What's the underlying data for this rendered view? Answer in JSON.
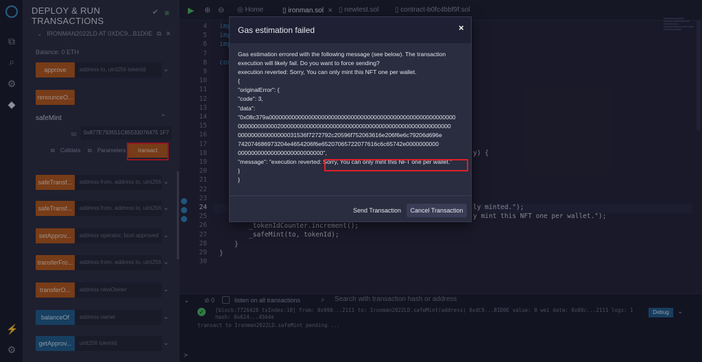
{
  "side_panel": {
    "title": "DEPLOY & RUN TRANSACTIONS",
    "contract_name": "IRONMAN2022LD AT 0XDC9...B1D0E",
    "balance": "Balance: 0 ETH",
    "functions": [
      {
        "label": "approve",
        "placeholder": "address to, uint256 tokenId",
        "color": "orange"
      },
      {
        "label": "renounceO...",
        "placeholder": "",
        "color": "orange"
      }
    ],
    "safemint": {
      "label": "safeMint",
      "to_label": "to:",
      "to_value": "0x877E793551C85533076475 1F7",
      "calldata_label": "Calldata",
      "parameters_label": "Parameters",
      "transact_label": "transact"
    },
    "more_functions": [
      {
        "label": "safeTransf...",
        "placeholder": "address from, address to, uint256",
        "color": "orange"
      },
      {
        "label": "safeTransf...",
        "placeholder": "address from, address to, uint256",
        "color": "orange"
      },
      {
        "label": "setApprov...",
        "placeholder": "address operator, bool approved",
        "color": "orange"
      },
      {
        "label": "transferFro...",
        "placeholder": "address from, address to, uint256",
        "color": "orange"
      },
      {
        "label": "transferO...",
        "placeholder": "address newOwner",
        "color": "orange"
      },
      {
        "label": "balanceOf",
        "placeholder": "address owner",
        "color": "blue"
      },
      {
        "label": "getApprov...",
        "placeholder": "uint256 tokenId",
        "color": "blue"
      }
    ]
  },
  "editor": {
    "tabs": [
      {
        "label": "Home"
      },
      {
        "label": "ironman.sol"
      },
      {
        "label": "newtest.sol"
      },
      {
        "label": "contract-b0fc4bbf9f.sol"
      }
    ],
    "line_numbers": [
      "4",
      "5",
      "6",
      "7",
      "8",
      "9",
      "10",
      "11",
      "12",
      "13",
      "14",
      "15",
      "16",
      "17",
      "18",
      "19",
      "20",
      "21",
      "22",
      "23",
      "24",
      "25",
      "26",
      "27",
      "28",
      "29",
      "30"
    ],
    "code_visible": [
      {
        "line": "4",
        "text": "imp"
      },
      {
        "line": "5",
        "text": "imp"
      },
      {
        "line": "6",
        "text": "imp"
      },
      {
        "line": "8",
        "text": "con"
      },
      {
        "line": "18",
        "text": "y) {"
      },
      {
        "line": "24",
        "text": "ly minted.\");"
      },
      {
        "line": "25",
        "text": "y mint this NFT one per wallet.\");"
      },
      {
        "line": "26",
        "text": "_tokenIdCounter.increment();"
      },
      {
        "line": "27",
        "text": "_safeMint(to, tokenId);"
      },
      {
        "line": "28",
        "text": "}"
      },
      {
        "line": "29",
        "text": "}"
      }
    ]
  },
  "terminal": {
    "count": "0",
    "listen_label": "listen on all transactions",
    "search_placeholder": "Search with transaction hash or address",
    "log_line1": "[block:7726428 txIndex:18]  from: 0x990...2111  to: Ironman2022LD.safeMint(address) 0xdC9...B1D0E  value: 0 wei  data: 0x08c...2111  logs: 1",
    "log_line2": "hash: 0x624...4564e",
    "log_line3": "transact to Ironman2022LD.safeMint pending ...",
    "debug_label": "Debug",
    "prompt": ">"
  },
  "modal": {
    "title": "Gas estimation failed",
    "close": "×",
    "lines": [
      "Gas estimation errored with the following message (see below). The transaction",
      "execution will likely fail. Do you want to force sending?",
      "execution reverted: Sorry, You can only mint this NFT one per wallet.",
      "{",
      "\"originalError\": {",
      "\"code\": 3,",
      "\"data\":",
      "\"0x08c379a000000000000000000000000000000000000000000000000000000000",
      "00000000000020000000000000000000000000000000000000000000000000000",
      "000000000000000031536f7272792c20596f752063616e206f6e6c79206d696e",
      "742074686973204e4654206f6e65207065722077616c6c65742e0000000000",
      "00000000000000000000000000\",",
      "\"message\": \"execution reverted: Sorry, You can only mint this NFT one per wallet.\"",
      "}",
      "}"
    ],
    "message_prefix": "\"message\": \"execution reverted: ",
    "message_highlight": "Sorry, You can only mint this NFT one per wallet.\"",
    "send_label": "Send Transaction",
    "cancel_label": "Cancel Transaction"
  },
  "colors": {
    "accent_orange": "#b2581c",
    "accent_blue": "#1f5c8a",
    "highlight_red": "#e0202a",
    "success_green": "#49b85e"
  }
}
